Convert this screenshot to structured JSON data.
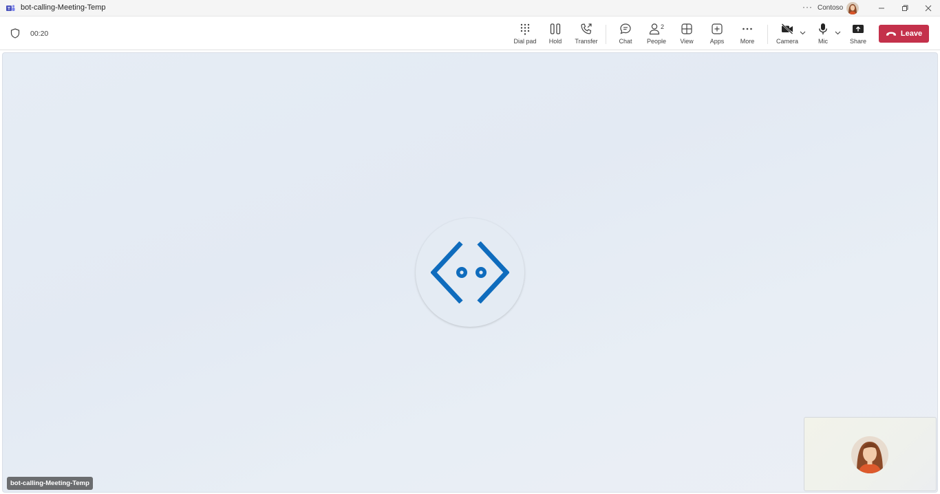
{
  "window": {
    "title": "bot-calling-Meeting-Temp",
    "org_name": "Contoso",
    "more_label": "···"
  },
  "toolbar": {
    "timer": "00:20",
    "buttons": {
      "dialpad": "Dial pad",
      "hold": "Hold",
      "transfer": "Transfer",
      "chat": "Chat",
      "people": "People",
      "people_count": "2",
      "view": "View",
      "apps": "Apps",
      "more": "More",
      "camera": "Camera",
      "mic": "Mic",
      "share": "Share"
    },
    "leave_label": "Leave"
  },
  "stage": {
    "participant_name": "bot-calling-Meeting-Temp"
  },
  "colors": {
    "leave": "#c4314b",
    "bot_icon": "#0f6cbd",
    "stage_bg": "#e6edf5"
  }
}
